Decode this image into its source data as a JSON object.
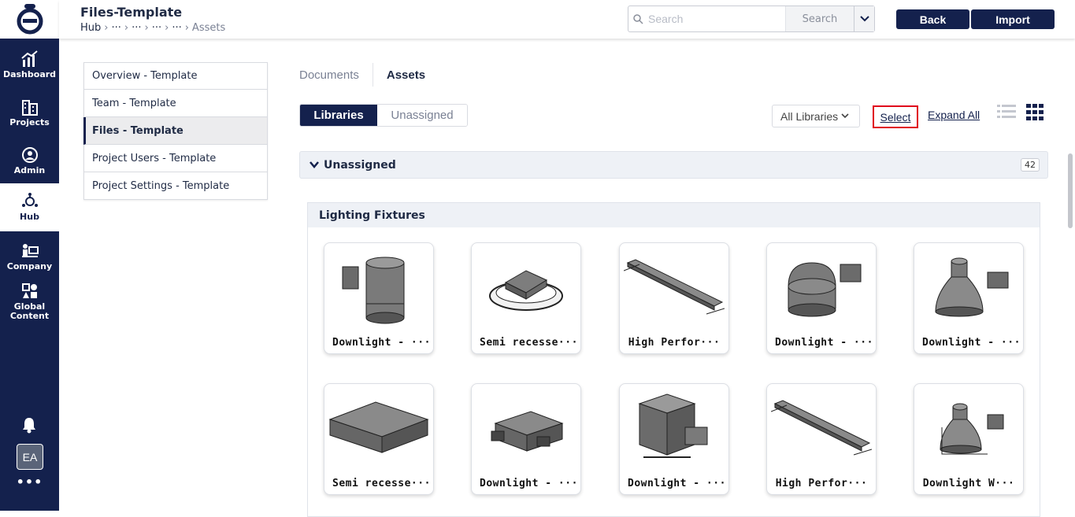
{
  "rail": {
    "items": [
      {
        "label": "Dashboard"
      },
      {
        "label": "Projects"
      },
      {
        "label": "Admin"
      },
      {
        "label": "Hub"
      },
      {
        "label": "Company"
      },
      {
        "label": "Global\nContent"
      }
    ],
    "avatar": "EA",
    "more": "•••"
  },
  "header": {
    "title": "Files-Template",
    "breadcrumb": [
      "Hub",
      "···",
      "···",
      "···",
      "···",
      "Assets"
    ],
    "search_placeholder": "Search",
    "search_button": "Search",
    "back_label": "Back",
    "import_label": "Import"
  },
  "leftnav": {
    "items": [
      {
        "label": "Overview - Template"
      },
      {
        "label": "Team - Template"
      },
      {
        "label": "Files - Template"
      },
      {
        "label": "Project Users - Template"
      },
      {
        "label": "Project Settings - Template"
      }
    ]
  },
  "tabs": {
    "documents": "Documents",
    "assets": "Assets"
  },
  "toolbar": {
    "libraries": "Libraries",
    "unassigned": "Unassigned",
    "library_filter": "All Libraries",
    "select": "Select",
    "expand_all": "Expand All"
  },
  "group": {
    "name": "Unassigned",
    "count": "42"
  },
  "library": {
    "name": "Lighting Fixtures",
    "cards": [
      {
        "label": "Downlight - ···"
      },
      {
        "label": "Semi recesse···"
      },
      {
        "label": "High Perfor···"
      },
      {
        "label": "Downlight - ···"
      },
      {
        "label": "Downlight - ···"
      },
      {
        "label": "Semi recesse···"
      },
      {
        "label": "Downlight - ···"
      },
      {
        "label": "Downlight - ···"
      },
      {
        "label": "High Perfor···"
      },
      {
        "label": "Downlight W···"
      }
    ]
  },
  "colors": {
    "navy": "#14214d",
    "highlight": "#e0001b"
  }
}
